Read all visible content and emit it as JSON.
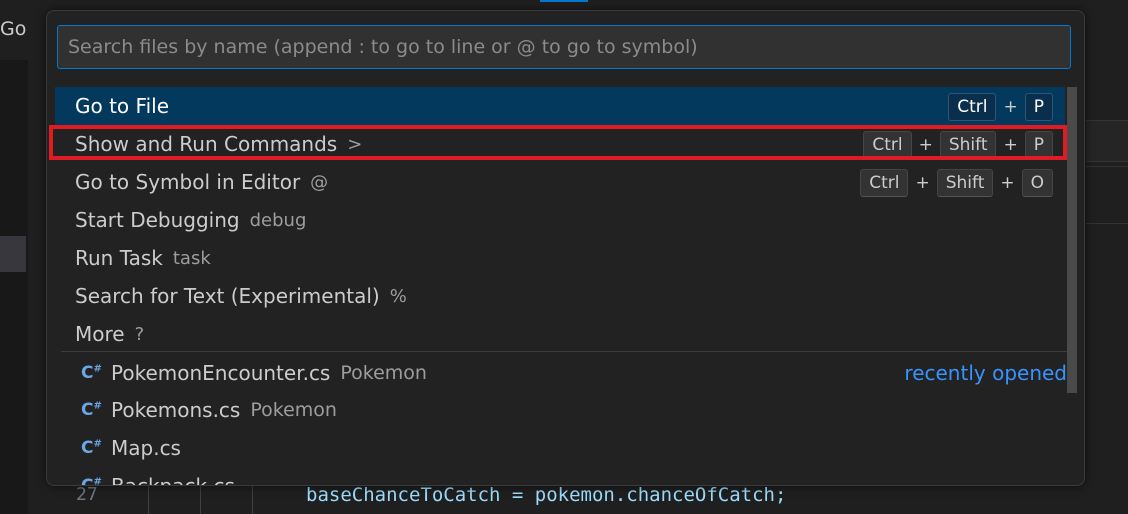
{
  "menubar": {
    "go_label": "Go"
  },
  "editor": {
    "line_number": "27",
    "code_line": "baseChanceToCatch = pokemon.chanceOfCatch;"
  },
  "quick_open": {
    "placeholder": "Search files by name (append : to go to line or @ to go to symbol)",
    "commands": [
      {
        "label": "Go to File",
        "hint": "",
        "keys": [
          "Ctrl",
          "P"
        ]
      },
      {
        "label": "Show and Run Commands",
        "hint": ">",
        "keys": [
          "Ctrl",
          "Shift",
          "P"
        ]
      },
      {
        "label": "Go to Symbol in Editor",
        "hint": "@",
        "keys": [
          "Ctrl",
          "Shift",
          "O"
        ]
      },
      {
        "label": "Start Debugging",
        "hint": "debug",
        "keys": []
      },
      {
        "label": "Run Task",
        "hint": "task",
        "keys": []
      },
      {
        "label": "Search for Text (Experimental)",
        "hint": "%",
        "keys": []
      },
      {
        "label": "More",
        "hint": "?",
        "keys": []
      }
    ],
    "plus": "+",
    "files": [
      {
        "icon": "csharp-file-icon",
        "name": "PokemonEncounter.cs",
        "folder": "Pokemon",
        "tag": "recently opened"
      },
      {
        "icon": "csharp-file-icon",
        "name": "Pokemons.cs",
        "folder": "Pokemon"
      },
      {
        "icon": "csharp-file-icon",
        "name": "Map.cs",
        "folder": ""
      },
      {
        "icon": "csharp-file-icon",
        "name": "Backpack.cs",
        "folder": ""
      }
    ]
  },
  "colors": {
    "accent": "#0078d4",
    "active_row": "#04395e",
    "highlight_box": "#e01b24",
    "link": "#3794ff"
  }
}
